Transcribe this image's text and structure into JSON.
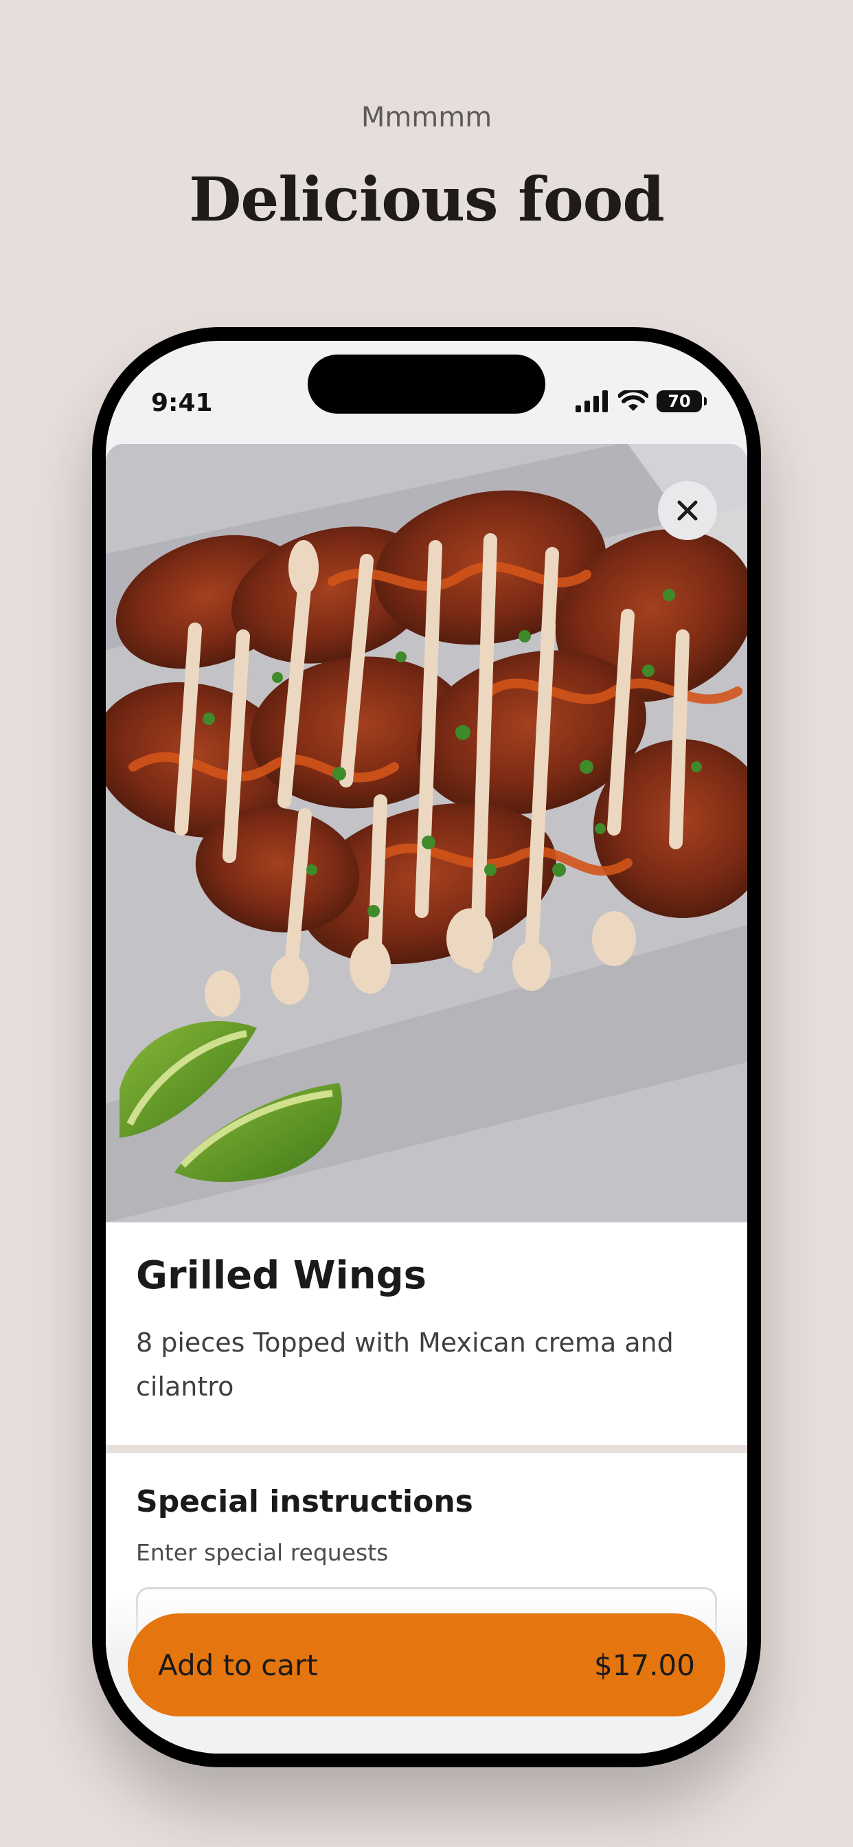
{
  "promo": {
    "subtitle": "Mmmmm",
    "headline": "Delicious food"
  },
  "status_bar": {
    "time": "9:41",
    "battery": "70",
    "icons": [
      "signal-icon",
      "wifi-icon",
      "battery-icon"
    ]
  },
  "item": {
    "photo": "grilled wings with crema drizzle and lime wedges",
    "close_icon": "close-icon",
    "name": "Grilled Wings",
    "description": "8 pieces Topped with Mexican crema and cilantro"
  },
  "special_instructions": {
    "title": "Special instructions",
    "hint": "Enter special requests",
    "value": ""
  },
  "cart": {
    "label": "Add to cart",
    "price": "$17.00"
  },
  "colors": {
    "page_background": "#e6dedb",
    "accent": "#e5760f",
    "text": "#1a1a1a"
  }
}
